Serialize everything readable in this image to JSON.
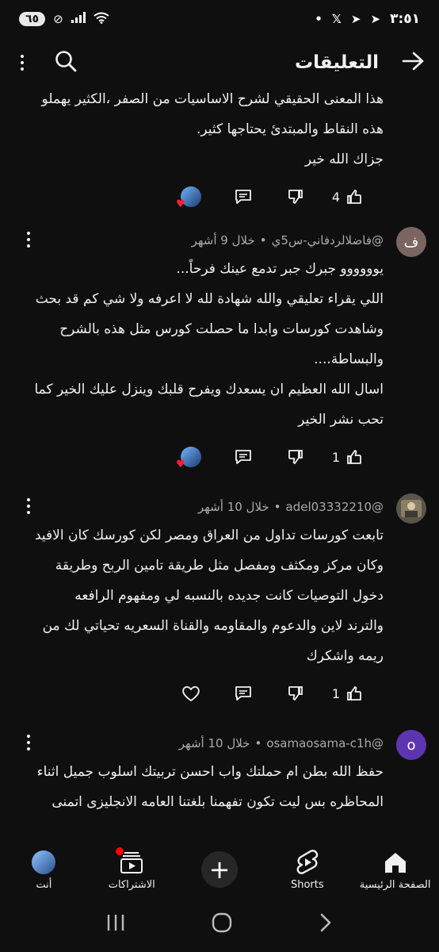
{
  "status_bar": {
    "battery": "٦٥",
    "time": "٣:٥١"
  },
  "header": {
    "title": "التعليقات"
  },
  "comments": [
    {
      "author": "",
      "when": "",
      "text_lines": [
        "هذا المعنى الحقيقي لشرح الاساسيات من الصفر ،الكثير يهملو",
        "هذه النقاط والمبتدئ يحتاجها كثير.",
        "جزاك الله خير"
      ],
      "likes": "4",
      "avatar_letter": "",
      "avatar_color": ""
    },
    {
      "author": "@فاضلالردفاني-س5ي",
      "when": "خلال 9 أشهر",
      "separator": "•",
      "text_lines": [
        "يوووووو جبرك جبر تدمع عينك فرحاً...",
        "اللي يقراء تعليقي والله شهادة لله لا اعرفه ولا شي كم قد بحث",
        "وشاهدت كورسات وابدا ما حصلت كورس مثل هذه بالشرح",
        "والبساطة....",
        "اسال الله العظيم ان يسعدك ويفرح قلبك وينزل عليك الخير كما",
        "تحب نشر الخير"
      ],
      "likes": "1",
      "avatar_letter": "ف",
      "avatar_color": "#7a6560"
    },
    {
      "author": "@adel03332210",
      "when": "خلال 10 أشهر",
      "separator": "•",
      "text_lines": [
        "تابعت كورسات تداول من العراق ومصر لكن كورسك  كان الافيد",
        "وكان  مركز ومكثف ومفصل  مثل طريقة تامين الربح وطريقة",
        "دخول التوصيات كانت جديده بالنسبه لي ومفهوم الرافعه",
        "والترند لاين والدعوم والمقاومه والقناة السعريه تحياتي لك من",
        "ريمه واشكرك"
      ],
      "likes": "1",
      "avatar_letter": "",
      "avatar_color": "#5a5548"
    },
    {
      "author": "@osamaosama-c1h",
      "when": "خلال 10 أشهر",
      "separator": "•",
      "text_lines": [
        "حفظ الله بطن ام حملتك واب احسن تربيتك اسلوب جميل اثناء",
        "المحاظره بس ليت تكون تفهمنا بلغتنا العامه الانجليزى اتمنى"
      ],
      "likes": "",
      "avatar_letter": "o",
      "avatar_color": "#5e35b1"
    }
  ],
  "bottom_nav": {
    "home": "الصفحة الرئيسية",
    "shorts": "Shorts",
    "add": "",
    "subscriptions": "الاشتراكات",
    "you": "أنت"
  },
  "icons": {
    "back": "arrow-right-icon",
    "search": "search-icon",
    "more": "kebab-icon",
    "like": "thumb-up-icon",
    "dislike": "thumb-down-icon",
    "reply": "comment-icon",
    "heart": "heart-icon"
  }
}
